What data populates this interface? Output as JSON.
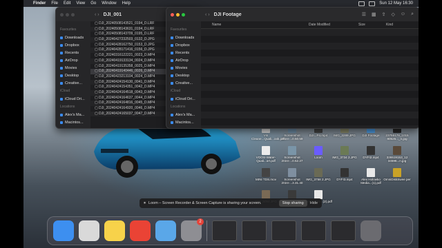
{
  "menubar": {
    "apple": "",
    "app_name": "Finder",
    "items": [
      "File",
      "Edit",
      "View",
      "Go",
      "Window",
      "Help"
    ],
    "datetime": "Sun 12 May  16:30"
  },
  "finder_left": {
    "title": "DJI_001",
    "sidebar_sections": [
      {
        "head": "Favourites",
        "items": [
          "Downloads",
          "Dropbox",
          "Recents",
          "AirDrop",
          "Movies",
          "Desktop",
          "Creative..."
        ]
      },
      {
        "head": "iCloud",
        "items": [
          "iCloud Dri..."
        ]
      },
      {
        "head": "Locations",
        "items": [
          "Alex's Ma...",
          "Macintos...",
          "Untitled"
        ]
      }
    ],
    "files": [
      "DJI_20240508143521_0194_D.LRF",
      "DJI_20240508143631_0194_D.LRF",
      "DJI_20240508143709_0195_D.LRF",
      "DJI_20240427232503_0132_D.JPG",
      "DJI_20240428162750_0153_D.JPG",
      "DJI_20240428171416_0156_D.JPG",
      "DJI_20240316122221_0023_D.MP4",
      "DJI_20240419133134_0024_D.MP4",
      "DJI_20240419135358_0025_D.MP4",
      "DJI_20240419140446_0026_D.MP4",
      "DJI_20240423213104_0024_D.MP4",
      "DJI_20240424154130_0041_D.MP4",
      "DJI_20240424154351_0042_D.MP4",
      "DJI_20240424164518_0043_D.MP4",
      "DJI_20240424164637_0044_D.MP4",
      "DJI_20240424164816_0045_D.MP4",
      "DJI_20240424164920_0046_D.MP4",
      "DJI_20240424165037_0047_D.MP4"
    ]
  },
  "finder_right": {
    "title": "DJI Footage",
    "sidebar_sections": [
      {
        "head": "Favourites",
        "items": [
          "Downloads",
          "Dropbox",
          "Recents",
          "AirDrop",
          "Movies",
          "Desktop",
          "Creative..."
        ]
      },
      {
        "head": "iCloud",
        "items": [
          "iCloud Dri..."
        ]
      },
      {
        "head": "Locations",
        "items": [
          "Alex's Ma...",
          "Macintos...",
          "Untitled"
        ]
      }
    ],
    "columns": [
      "Name",
      "Date Modified",
      "Size",
      "Kind"
    ]
  },
  "desktop_icons": [
    {
      "label": "Vin Cleane...Quali...ook.pdf",
      "color": "#dcdcdc"
    },
    {
      "label": "Screenshot 2024-...0.50.59",
      "color": "#6f8fa8"
    },
    {
      "label": "DJI...P4.mp4",
      "color": "#444"
    },
    {
      "label": "IMG_3289.JPG",
      "color": "#8a8a6a"
    },
    {
      "label": "DJI Footage",
      "color": "#4fa0e8"
    },
    {
      "label": "23755179_1015 80525..._n.jpg",
      "color": "#2a2a2a"
    },
    {
      "label": "VOOS-Water-Quali...ort.pdf",
      "color": "#ececec"
    },
    {
      "label": "Screenshot 2024-...0.52.27",
      "color": "#7a95a8"
    },
    {
      "label": "Loom",
      "color": "#6a5cff"
    },
    {
      "label": "IMG_3734 2.JPG",
      "color": "#6b7a55"
    },
    {
      "label": "DYFI2.mp4",
      "color": "#333"
    },
    {
      "label": "326519153_12 34596...n.jpg",
      "color": "#5a4a3a"
    },
    {
      "label": "MINI TDS.mov",
      "color": "#444"
    },
    {
      "label": "Screenshot 2024-...3.31.40",
      "color": "#7f8fa0"
    },
    {
      "label": "IMG_3758 2.JPG",
      "color": "#6a6a55"
    },
    {
      "label": "DYFI3.mp4",
      "color": "#333"
    },
    {
      "label": "Alex Holowko Media...(1).pdf",
      "color": "#e8e8e8"
    },
    {
      "label": "OmniDiskSwee per",
      "color": "#c9a227"
    },
    {
      "label": "IMG_5094.JPG",
      "color": "#7a6a55"
    },
    {
      "label": "Garmin Edge Unbox....mov",
      "color": "#3a3a3a"
    },
    {
      "label": "Alex Holow...(2).pdf",
      "color": "#e8e8e8"
    }
  ],
  "share_banner": {
    "text": "Loom – Screen Recorder & Screen Capture is sharing your screen.",
    "stop_label": "Stop sharing",
    "hide_label": "Hide"
  },
  "dock": {
    "apps": [
      {
        "name": "Finder",
        "color": "#3d8ff0"
      },
      {
        "name": "Launchpad",
        "color": "#d9d9d9"
      },
      {
        "name": "Notes",
        "color": "#f7d24a"
      },
      {
        "name": "Chrome",
        "color": "#ea4335"
      },
      {
        "name": "QuickTime",
        "color": "#5aa7e8"
      },
      {
        "name": "System Settings",
        "color": "#8e8e93",
        "badge": "2"
      }
    ]
  },
  "colors": {
    "accent": "#3b8cf5",
    "window_bg": "#1e1e20"
  }
}
